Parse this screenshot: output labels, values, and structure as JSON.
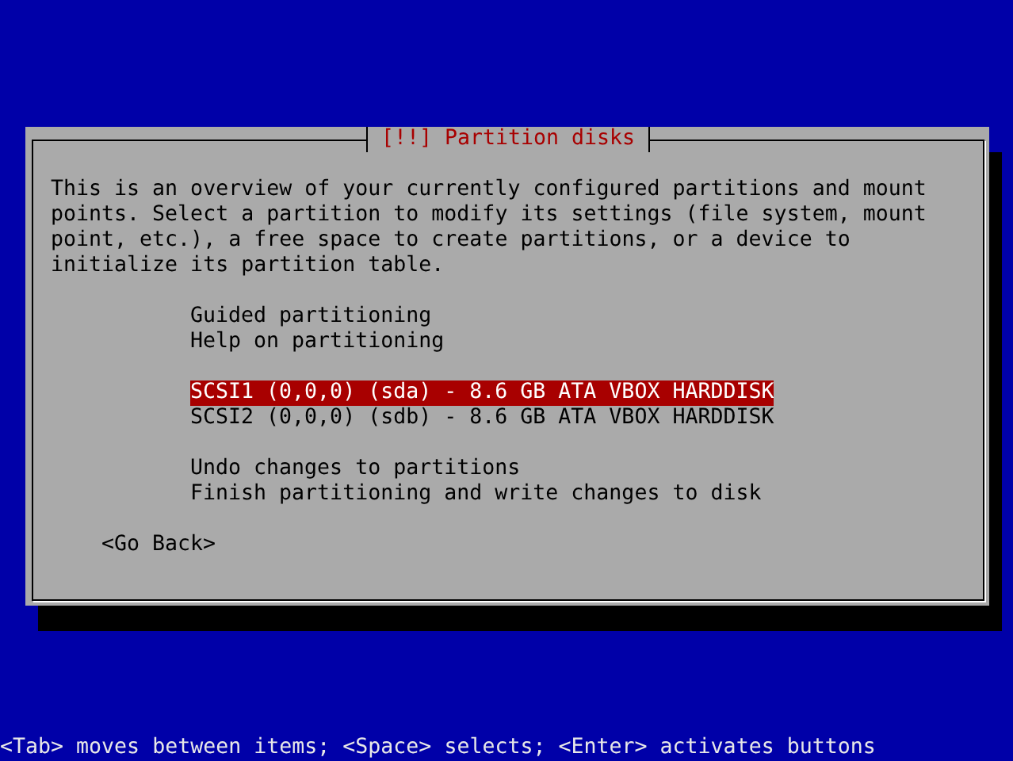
{
  "dialog": {
    "title": "[!!] Partition disks",
    "description": "This is an overview of your currently configured partitions and mount points. Select a partition to modify its settings (file system, mount point, etc.), a free space to create partitions, or a device to initialize its partition table.",
    "menu_groups": [
      [
        {
          "label": "Guided partitioning",
          "selected": false
        },
        {
          "label": "Help on partitioning",
          "selected": false
        }
      ],
      [
        {
          "label": "SCSI1 (0,0,0) (sda) - 8.6 GB ATA VBOX HARDDISK",
          "selected": true
        },
        {
          "label": "SCSI2 (0,0,0) (sdb) - 8.6 GB ATA VBOX HARDDISK",
          "selected": false
        }
      ],
      [
        {
          "label": "Undo changes to partitions",
          "selected": false
        },
        {
          "label": "Finish partitioning and write changes to disk",
          "selected": false
        }
      ]
    ],
    "buttons": [
      {
        "label": "<Go Back>"
      }
    ]
  },
  "status_bar": "<Tab> moves between items; <Space> selects; <Enter> activates buttons"
}
